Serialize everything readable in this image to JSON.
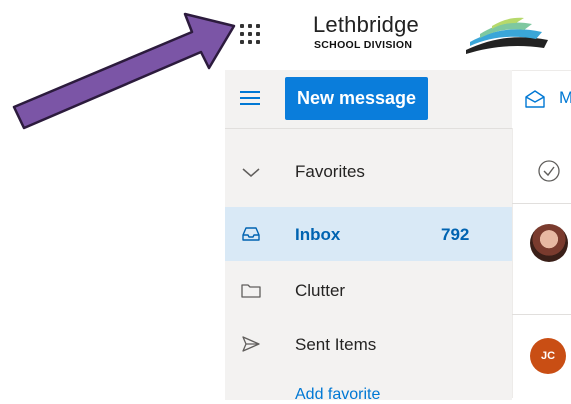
{
  "header": {
    "app_launcher_icon": "waffle-icon",
    "brand_name": "Lethbridge",
    "brand_subtitle": "SCHOOL DIVISION"
  },
  "toolbar": {
    "new_message_label": "New message",
    "mail_action_label": "M"
  },
  "sidebar": {
    "favorites_label": "Favorites",
    "items": [
      {
        "label": "Inbox",
        "count": "792",
        "icon": "inbox-icon",
        "selected": true
      },
      {
        "label": "Clutter",
        "icon": "folder-icon"
      },
      {
        "label": "Sent Items",
        "icon": "send-icon"
      }
    ],
    "add_favorite_label": "Add favorite"
  },
  "message_list": {
    "items": [
      {
        "avatar": "photo"
      },
      {
        "avatar_initials": "JC"
      }
    ]
  },
  "colors": {
    "accent": "#0078d4",
    "selected_row": "#d9e9f6",
    "rail_bg": "#f3f2f1",
    "arrow": "#7b55a6",
    "avatar_jc": "#c94e14"
  }
}
